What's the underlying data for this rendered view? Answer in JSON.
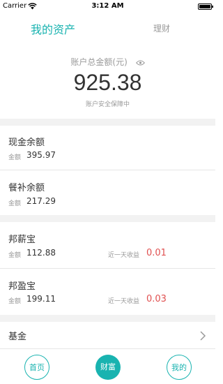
{
  "status_bar": {
    "carrier": "Carrier",
    "time": "3:12 AM",
    "wifi_icon": "wifi-icon",
    "battery_icon": "battery-icon"
  },
  "tabs": {
    "assets": "我的资产",
    "finance": "理财"
  },
  "summary": {
    "label": "账户总金额(元)",
    "amount": "925.38",
    "note": "账户安全保障中",
    "eye_icon": "eye-icon"
  },
  "cash": [
    {
      "title": "现金余额",
      "amount_label": "金额",
      "amount": "395.97"
    },
    {
      "title": "餐补余额",
      "amount_label": "金额",
      "amount": "217.29"
    }
  ],
  "products": [
    {
      "title": "邦薪宝",
      "amount_label": "金额",
      "amount": "112.88",
      "yield_label": "近一天收益",
      "yield": "0.01"
    },
    {
      "title": "邦盈宝",
      "amount_label": "金额",
      "amount": "199.11",
      "yield_label": "近一天收益",
      "yield": "0.03"
    }
  ],
  "fund": {
    "title": "基金",
    "chevron_icon": "chevron-right-icon"
  },
  "tabbar": {
    "home": "首页",
    "wealth": "财富",
    "mine": "我的"
  },
  "colors": {
    "accent": "#19b3b0",
    "yield": "#e05050",
    "muted": "#9a9a9a"
  }
}
